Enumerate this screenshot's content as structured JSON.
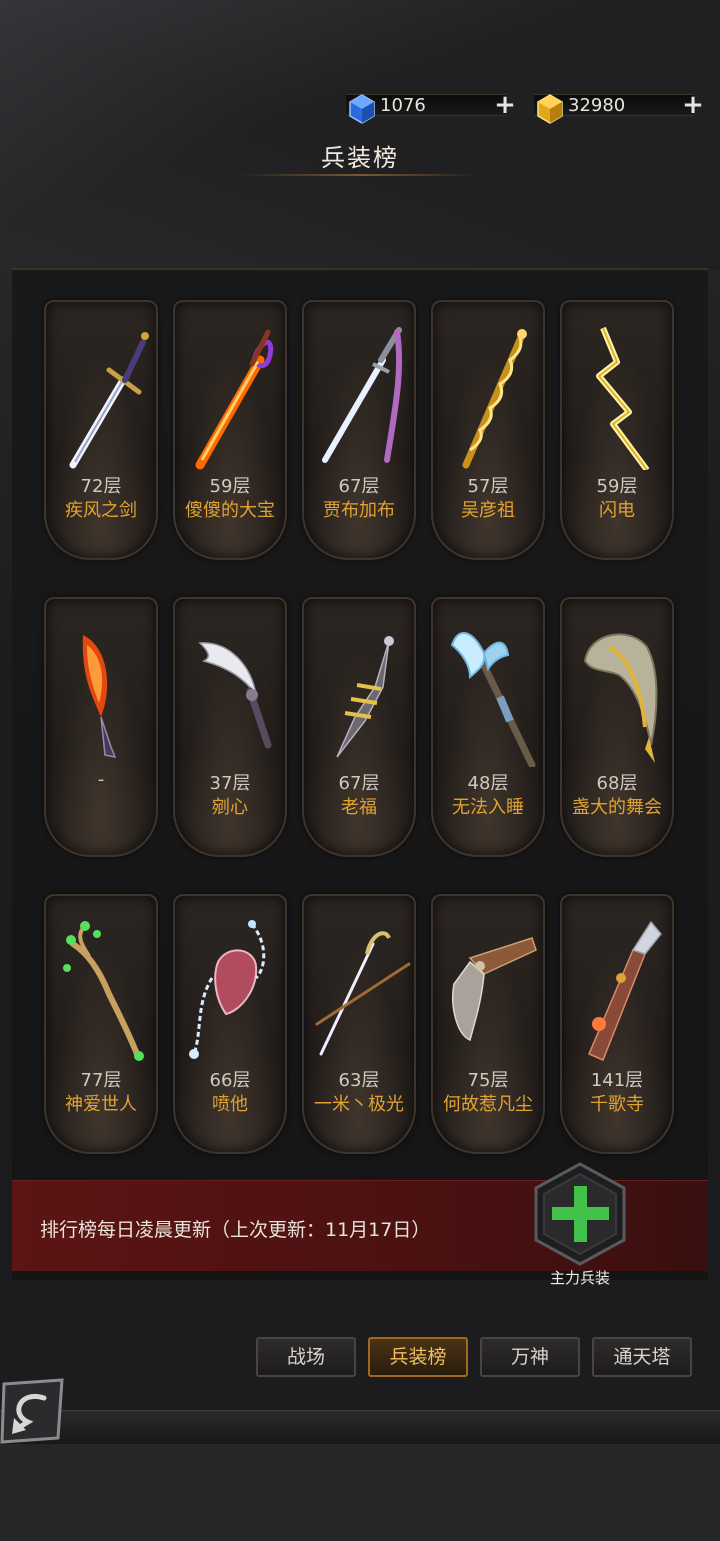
{
  "currency": {
    "gems": "1076",
    "gold": "32980"
  },
  "title": "兵装榜",
  "cards": [
    {
      "floor": "72层",
      "owner": "疾风之剑",
      "icon": "sword-icon"
    },
    {
      "floor": "59层",
      "owner": "傻傻的大宝",
      "icon": "flame-sword-icon"
    },
    {
      "floor": "67层",
      "owner": "贾布加布",
      "icon": "katana-icon"
    },
    {
      "floor": "57层",
      "owner": "吴彦祖",
      "icon": "golden-staff-icon"
    },
    {
      "floor": "59层",
      "owner": "闪电",
      "icon": "lightning-icon"
    },
    {
      "floor": "-",
      "owner": "",
      "icon": "fire-blade-icon"
    },
    {
      "floor": "37层",
      "owner": "剜心",
      "icon": "curved-dagger-icon"
    },
    {
      "floor": "67层",
      "owner": "老福",
      "icon": "serrated-dagger-icon"
    },
    {
      "floor": "48层",
      "owner": "无法入睡",
      "icon": "axe-icon"
    },
    {
      "floor": "68层",
      "owner": "盏大的舞会",
      "icon": "horn-blade-icon"
    },
    {
      "floor": "77层",
      "owner": "神爱世人",
      "icon": "branch-staff-icon"
    },
    {
      "floor": "66层",
      "owner": "喷他",
      "icon": "chain-gauntlet-icon"
    },
    {
      "floor": "63层",
      "owner": "一米丶极光",
      "icon": "rapier-icon"
    },
    {
      "floor": "75层",
      "owner": "何故惹凡尘",
      "icon": "pistol-icon"
    },
    {
      "floor": "141层",
      "owner": "千歌寺",
      "icon": "gun-axe-icon"
    }
  ],
  "notice": "排行榜每日凌晨更新（上次更新：11月17日）",
  "main_weapon_label": "主力兵装",
  "tabs": [
    "战场",
    "兵装榜",
    "万神",
    "通天塔"
  ],
  "active_tab": "兵装榜"
}
